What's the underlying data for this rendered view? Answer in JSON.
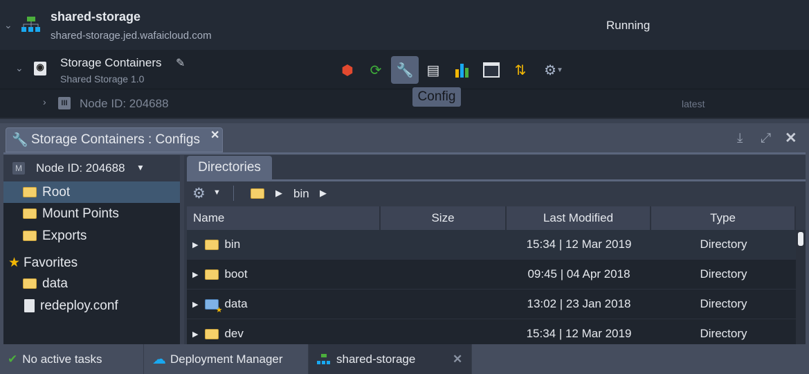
{
  "env": {
    "name": "shared-storage",
    "domain": "shared-storage.jed.wafaicloud.com",
    "status": "Running"
  },
  "layer": {
    "name": "Storage Containers",
    "version": "Shared Storage 1.0"
  },
  "node": {
    "label": "Node ID: 204688",
    "tag": "latest"
  },
  "tools": [
    "add-ons",
    "restart",
    "config",
    "log",
    "statistics",
    "web-ssh",
    "redeploy",
    "settings"
  ],
  "tooltip": "Config",
  "panel": {
    "title": "Storage Containers : Configs"
  },
  "tree": {
    "node_selector": "Node ID: 204688",
    "node_badge": "M",
    "items": [
      {
        "label": "Root",
        "selected": true
      },
      {
        "label": "Mount Points"
      },
      {
        "label": "Exports"
      }
    ],
    "favorites_label": "Favorites",
    "favorites": [
      {
        "label": "data",
        "type": "folder"
      },
      {
        "label": "redeploy.conf",
        "type": "file"
      }
    ]
  },
  "dirs": {
    "tab": "Directories",
    "breadcrumb": "bin",
    "columns": [
      "Name",
      "Size",
      "Last Modified",
      "Type"
    ],
    "rows": [
      {
        "name": "bin",
        "size": "",
        "modified": "15:34 | 12 Mar 2019",
        "type": "Directory"
      },
      {
        "name": "boot",
        "size": "",
        "modified": "09:45 | 04 Apr 2018",
        "type": "Directory"
      },
      {
        "name": "data",
        "size": "",
        "modified": "13:02 | 23 Jan 2018",
        "type": "Directory"
      },
      {
        "name": "dev",
        "size": "",
        "modified": "15:34 | 12 Mar 2019",
        "type": "Directory"
      }
    ]
  },
  "bottom": {
    "tasks": "No active tasks",
    "deploy": "Deployment Manager",
    "env_tab": "shared-storage"
  },
  "colors": {
    "selected": "#3f5872",
    "accent": "#5b667d",
    "folder": "#f5d06a"
  }
}
